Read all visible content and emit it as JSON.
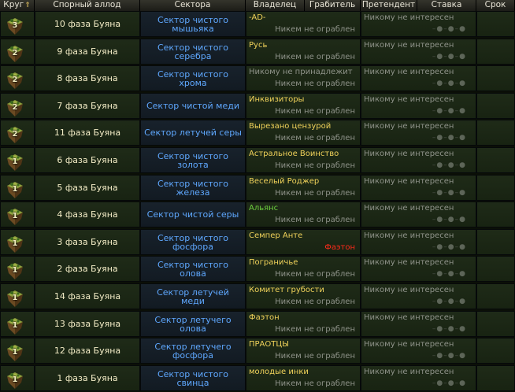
{
  "header": {
    "columns": [
      "Круг",
      "Спорный аллод",
      "Сектора",
      "Владелец",
      "Грабитель",
      "Претендент",
      "Ставка",
      "Срок"
    ],
    "sort_arrow": "⇑"
  },
  "rows": [
    {
      "round": "3",
      "allod": "10 фаза Буяна",
      "sector": "Сектор чистого мышьяка",
      "owner": "-AD-",
      "owner_style": "yellow",
      "robber": "Никем не ограблен",
      "claimant": "Никому не интересен"
    },
    {
      "round": "2",
      "allod": "9 фаза Буяна",
      "sector": "Сектор чистого серебра",
      "owner": "Русь",
      "owner_style": "yellow",
      "robber": "Никем не ограблен",
      "claimant": "Никому не интересен"
    },
    {
      "round": "2",
      "allod": "8 фаза Буяна",
      "sector": "Сектор чистого хрома",
      "owner": "Никому не принадлежит",
      "owner_style": "gray",
      "robber": "Никем не ограблен",
      "claimant": "Никому не интересен"
    },
    {
      "round": "2",
      "allod": "7 фаза Буяна",
      "sector": "Сектор чистой меди",
      "owner": "Инквизиторы",
      "owner_style": "yellow",
      "robber": "Никем не ограблен",
      "claimant": "Никому не интересен"
    },
    {
      "round": "2",
      "allod": "11 фаза Буяна",
      "sector": "Сектор летучей серы",
      "owner": "Вырезано цензурой",
      "owner_style": "yellow",
      "robber": "Никем не ограблен",
      "claimant": "Никому не интересен"
    },
    {
      "round": "1",
      "allod": "6 фаза Буяна",
      "sector": "Сектор чистого золота",
      "owner": "Астральное Воинство",
      "owner_style": "yellow",
      "robber": "Никем не ограблен",
      "claimant": "Никому не интересен"
    },
    {
      "round": "1",
      "allod": "5 фаза Буяна",
      "sector": "Сектор чистого железа",
      "owner": "Веселый Роджер",
      "owner_style": "yellow",
      "robber": "Никем не ограблен",
      "claimant": "Никому не интересен"
    },
    {
      "round": "1",
      "allod": "4 фаза Буяна",
      "sector": "Сектор чистой серы",
      "owner": "Альянс",
      "owner_style": "green",
      "robber": "Никем не ограблен",
      "claimant": "Никому не интересен"
    },
    {
      "round": "1",
      "allod": "3 фаза Буяна",
      "sector": "Сектор чистого фосфора",
      "owner": "Семпер Анте",
      "owner_style": "yellow",
      "robber": "Фаэтон",
      "robber_style": "red",
      "claimant": "Никому не интересен"
    },
    {
      "round": "1",
      "allod": "2 фаза Буяна",
      "sector": "Сектор чистого олова",
      "owner": "Пограничье",
      "owner_style": "yellow",
      "robber": "Никем не ограблен",
      "claimant": "Никому не интересен"
    },
    {
      "round": "1",
      "allod": "14 фаза Буяна",
      "sector": "Сектор летучей меди",
      "owner": "Комитет грубости",
      "owner_style": "yellow",
      "robber": "Никем не ограблен",
      "claimant": "Никому не интересен"
    },
    {
      "round": "1",
      "allod": "13 фаза Буяна",
      "sector": "Сектор летучего олова",
      "owner": "Фаэтон",
      "owner_style": "yellow",
      "robber": "Никем не ограблен",
      "claimant": "Никому не интересен"
    },
    {
      "round": "1",
      "allod": "12 фаза Буяна",
      "sector": "Сектор летучего фосфора",
      "owner": "ПРАОТЦЫ",
      "owner_style": "yellow",
      "robber": "Никем не ограблен",
      "claimant": "Никому не интересен"
    },
    {
      "round": "1",
      "allod": "1 фаза Буяна",
      "sector": "Сектор чистого свинца",
      "owner": "молодые инки",
      "owner_style": "yellow",
      "robber": "Никем не ограблен",
      "claimant": "Никому не интересен"
    }
  ],
  "colors": {
    "owner_yellow": "#f0d25a",
    "owner_green": "#6ccc3e",
    "robber_red": "#ff2a1a",
    "sector_blue": "#5fa8ff",
    "muted_gray": "#8f938a"
  },
  "icons": {
    "round": "island-icon",
    "bid_dots": "bid-dots-icon"
  }
}
